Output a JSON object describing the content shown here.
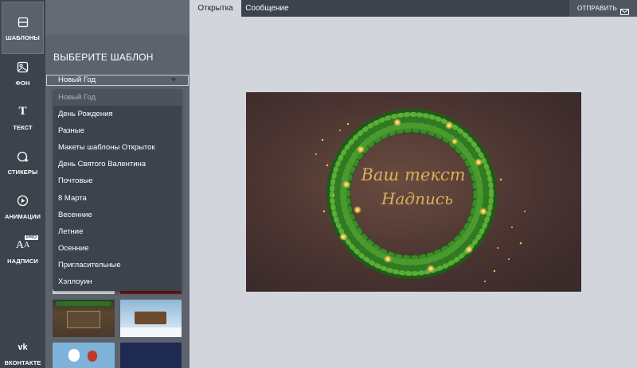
{
  "rail": {
    "templates": "ШАБЛОНЫ",
    "background": "ФОН",
    "text": "ТЕКСТ",
    "stickers": "СТИКЕРЫ",
    "animations": "АНИМАЦИИ",
    "captions": "НАДПИСИ",
    "pro_badge": "PRO",
    "vk": "ВКОНТАКТЕ"
  },
  "panel": {
    "title": "ВЫБЕРИТЕ ШАБЛОН",
    "selected_category": "Новый Год"
  },
  "dropdown": {
    "options": [
      "Новый Год",
      "День Рождения",
      "Разные",
      "Макеты шаблоны Открыток",
      "День Святого Валентина",
      "Почтовые",
      "8 Марта",
      "Весенние",
      "Летние",
      "Осенние",
      "Пригласительные",
      "Хэллоуин"
    ]
  },
  "tabs": {
    "card": "Открытка",
    "message": "Сообщение"
  },
  "send_label": "ОТПРАВИТЬ",
  "card": {
    "line1": "Ваш текст",
    "line2": "Надпись"
  },
  "colors": {
    "rail_bg": "#3d434c",
    "panel_bg": "#5c636d",
    "canvas_bg": "#d2d5dc",
    "card_bg": "#4d3633",
    "wreath_green": "#3f8c2a",
    "gold": "#d9b15a"
  }
}
